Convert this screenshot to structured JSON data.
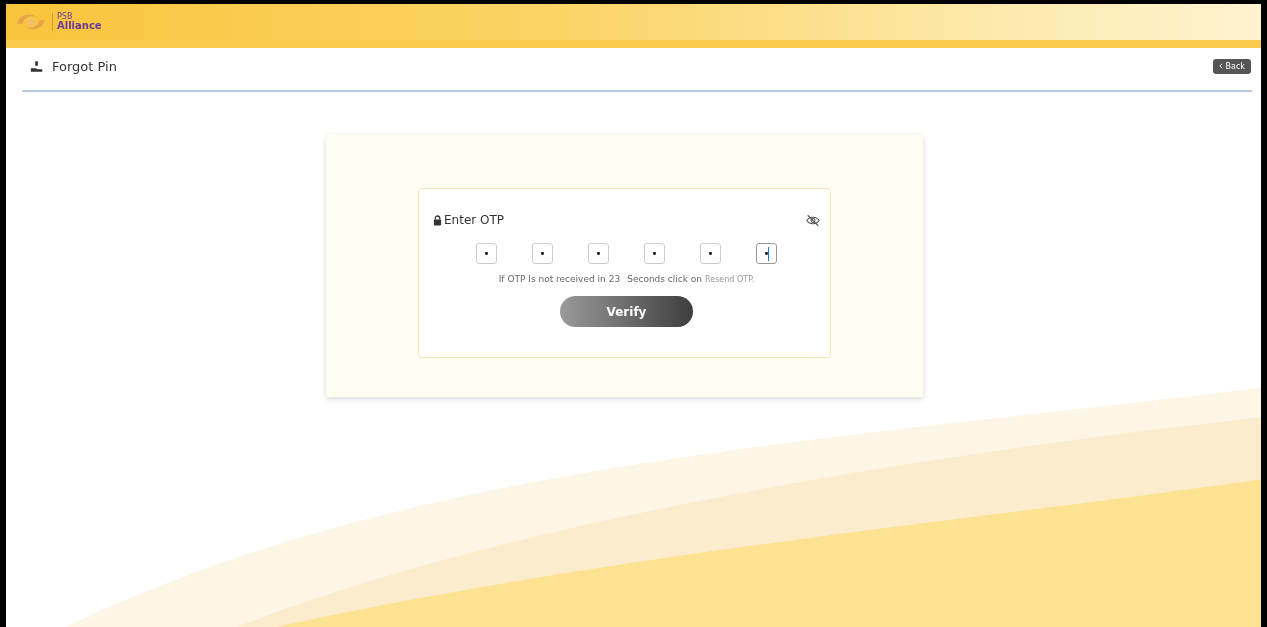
{
  "header": {
    "logo": {
      "line_1": "PSB",
      "line_2": "Alliance"
    }
  },
  "page": {
    "title": "Forgot Pin",
    "back_button": "Back"
  },
  "otp_panel": {
    "label": "Enter OTP",
    "masked": true,
    "digits": [
      {
        "value": "•",
        "focused": false
      },
      {
        "value": "•",
        "focused": false
      },
      {
        "value": "•",
        "focused": false
      },
      {
        "value": "•",
        "focused": false
      },
      {
        "value": "•",
        "focused": false
      },
      {
        "value": "•",
        "focused": true
      }
    ],
    "note_prefix": "If OTP Is not received in",
    "countdown": "23",
    "note_suffix": "Seconds click on",
    "resend_link": "Resend OTP.",
    "verify_button": "Verify"
  }
}
